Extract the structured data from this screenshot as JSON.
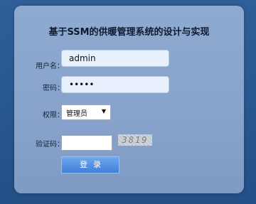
{
  "page": {
    "title": "基于SSM的供暖管理系统的设计与实现"
  },
  "form": {
    "username_label": "用户名：",
    "username_value": "admin",
    "password_label": "密码：",
    "password_value": "•••••",
    "role_label": "权限：",
    "role_selected": "管理员",
    "captcha_label": "验证码：",
    "captcha_input_value": "",
    "captcha_text": "3819",
    "login_button": "登录"
  },
  "colors": {
    "background": "#2a5a94",
    "panel": "#8faad0",
    "button": "#3f7fd9"
  },
  "icons": {
    "select_arrow": "chevron-down-icon"
  }
}
